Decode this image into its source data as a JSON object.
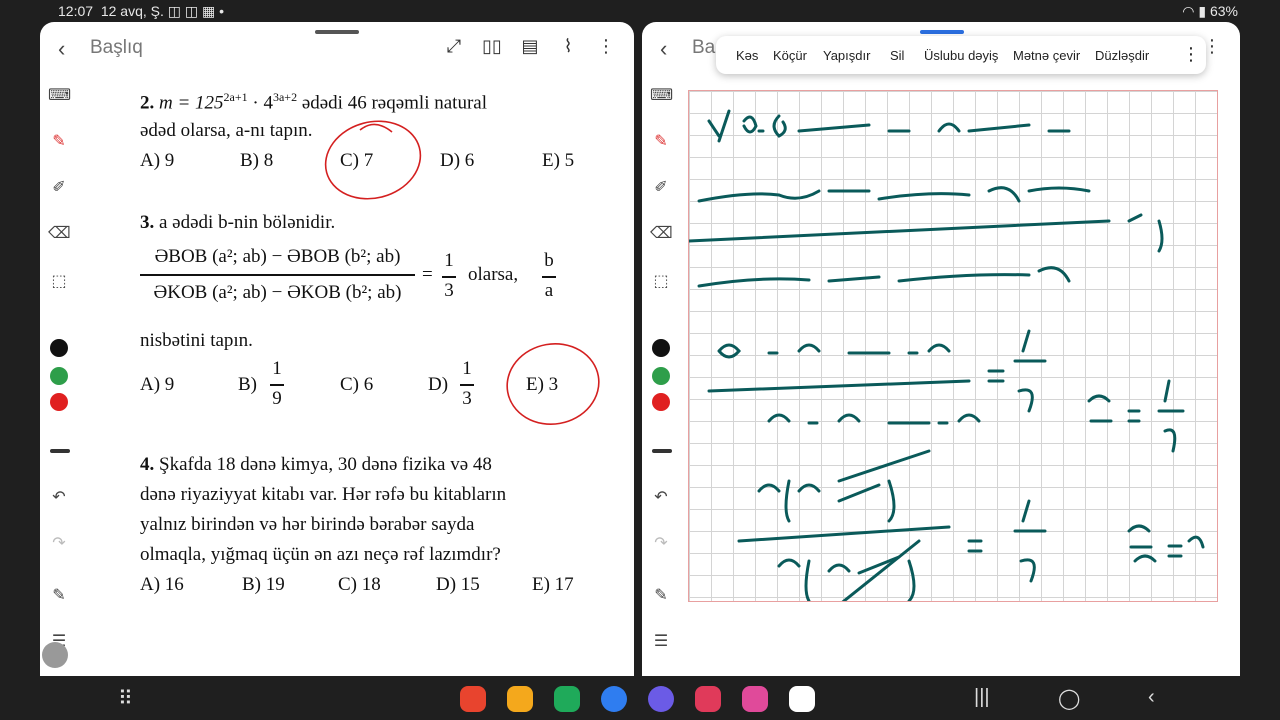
{
  "status": {
    "time": "12:07",
    "date": "12 avq, Ş.",
    "battery": "63%"
  },
  "left": {
    "title": "Başlıq",
    "q2": {
      "num": "2.",
      "text1": "m = 125",
      "exp1": "2a+1",
      "text2": " · 4",
      "exp2": "3a+2",
      "text3": "  ədədi 46 rəqəmli natural",
      "line2": "ədəd olarsa, a-nı tapın.",
      "answers": [
        "A) 9",
        "B) 8",
        "C) 7",
        "D) 6",
        "E) 5"
      ]
    },
    "q3": {
      "num": "3.",
      "text": "a ədədi b-nin bölənidir.",
      "numerator": "ƏBOB (a²; ab) − ƏBOB (b²; ab)",
      "denominator": "ƏKOB (a²; ab) − ƏKOB (b²; ab)",
      "eq": "=",
      "one": "1",
      "three": "3",
      "olarsa": "olarsa,",
      "b": "b",
      "a": "a",
      "line3": "nisbətini tapın.",
      "answers": [
        "A) 9",
        "B)",
        "C) 6",
        "D)",
        "E) 3"
      ],
      "b_num": "1",
      "b_den": "9",
      "d_num": "1",
      "d_den": "3"
    },
    "q4": {
      "num": "4.",
      "line1": "Şkafda 18 dənə kimya, 30 dənə fizika və 48",
      "line2": "dənə riyaziyyat kitabı var. Hər rəfə bu kitabların",
      "line3": "yalnız birindən  və hər birində bərabər sayda",
      "line4": "olmaqla, yığmaq üçün ən azı neçə rəf lazımdır?",
      "answers": [
        "A) 16",
        "B) 19",
        "C) 18",
        "D) 15",
        "E) 17"
      ]
    }
  },
  "right": {
    "title": "Ba",
    "menu": [
      "Kəs",
      "Köçür",
      "Yapışdır",
      "Sil",
      "Üslubu dəyiş",
      "Mətnə çevir",
      "Düzləşdir"
    ]
  },
  "colors": {
    "black": "#111111",
    "green": "#2e9e4a",
    "red": "#e02020",
    "ink": "#0a5a5a",
    "circle": "#d42020"
  }
}
